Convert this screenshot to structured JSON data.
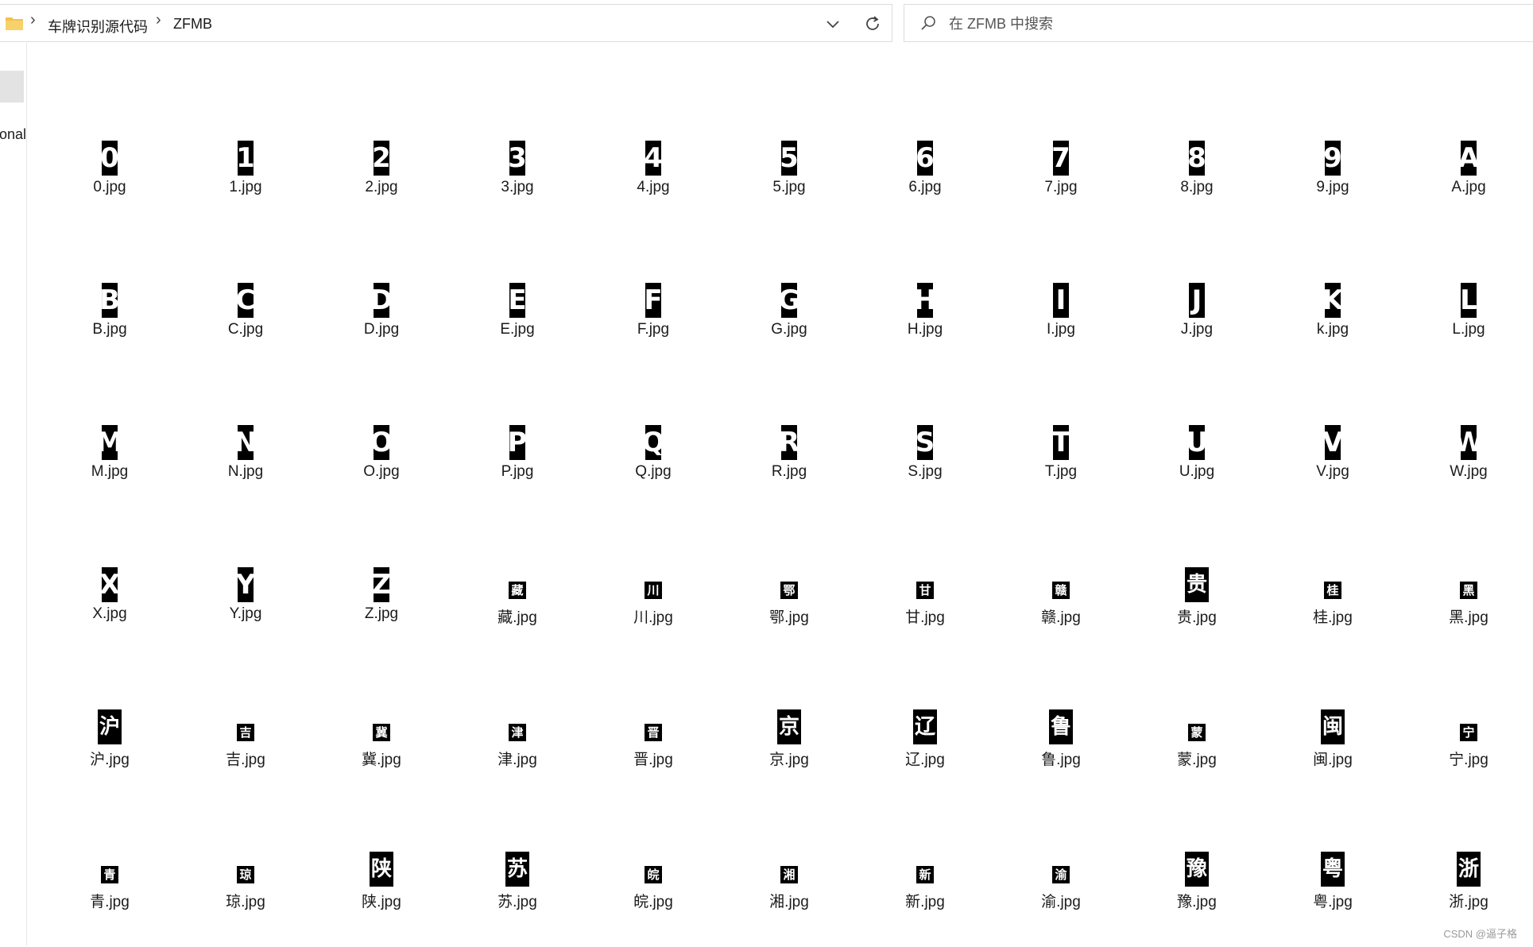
{
  "address_bar": {
    "crumbs": [
      "车牌识别源代码",
      "ZFMB"
    ],
    "separator": "›"
  },
  "search": {
    "placeholder": "在 ZFMB 中搜索"
  },
  "nav": {
    "visible_text": "onal"
  },
  "watermark": "CSDN @逼子格",
  "files": [
    {
      "glyph": "0",
      "name": "0.jpg",
      "size": "big"
    },
    {
      "glyph": "1",
      "name": "1.jpg",
      "size": "big"
    },
    {
      "glyph": "2",
      "name": "2.jpg",
      "size": "big"
    },
    {
      "glyph": "3",
      "name": "3.jpg",
      "size": "big"
    },
    {
      "glyph": "4",
      "name": "4.jpg",
      "size": "big"
    },
    {
      "glyph": "5",
      "name": "5.jpg",
      "size": "big"
    },
    {
      "glyph": "6",
      "name": "6.jpg",
      "size": "big"
    },
    {
      "glyph": "7",
      "name": "7.jpg",
      "size": "big"
    },
    {
      "glyph": "8",
      "name": "8.jpg",
      "size": "big"
    },
    {
      "glyph": "9",
      "name": "9.jpg",
      "size": "big"
    },
    {
      "glyph": "A",
      "name": "A.jpg",
      "size": "big"
    },
    {
      "glyph": "B",
      "name": "B.jpg",
      "size": "big"
    },
    {
      "glyph": "C",
      "name": "C.jpg",
      "size": "big"
    },
    {
      "glyph": "D",
      "name": "D.jpg",
      "size": "big"
    },
    {
      "glyph": "E",
      "name": "E.jpg",
      "size": "big"
    },
    {
      "glyph": "F",
      "name": "F.jpg",
      "size": "big"
    },
    {
      "glyph": "G",
      "name": "G.jpg",
      "size": "big"
    },
    {
      "glyph": "H",
      "name": "H.jpg",
      "size": "big"
    },
    {
      "glyph": "I",
      "name": "I.jpg",
      "size": "big"
    },
    {
      "glyph": "J",
      "name": "J.jpg",
      "size": "big"
    },
    {
      "glyph": "K",
      "name": "k.jpg",
      "size": "big"
    },
    {
      "glyph": "L",
      "name": "L.jpg",
      "size": "big"
    },
    {
      "glyph": "M",
      "name": "M.jpg",
      "size": "big"
    },
    {
      "glyph": "N",
      "name": "N.jpg",
      "size": "big"
    },
    {
      "glyph": "O",
      "name": "O.jpg",
      "size": "big"
    },
    {
      "glyph": "P",
      "name": "P.jpg",
      "size": "big"
    },
    {
      "glyph": "Q",
      "name": "Q.jpg",
      "size": "big"
    },
    {
      "glyph": "R",
      "name": "R.jpg",
      "size": "big"
    },
    {
      "glyph": "S",
      "name": "S.jpg",
      "size": "big"
    },
    {
      "glyph": "T",
      "name": "T.jpg",
      "size": "big"
    },
    {
      "glyph": "U",
      "name": "U.jpg",
      "size": "big"
    },
    {
      "glyph": "V",
      "name": "V.jpg",
      "size": "big"
    },
    {
      "glyph": "W",
      "name": "W.jpg",
      "size": "big"
    },
    {
      "glyph": "X",
      "name": "X.jpg",
      "size": "big"
    },
    {
      "glyph": "Y",
      "name": "Y.jpg",
      "size": "big"
    },
    {
      "glyph": "Z",
      "name": "Z.jpg",
      "size": "big"
    },
    {
      "glyph": "藏",
      "name": "藏.jpg",
      "size": "small"
    },
    {
      "glyph": "川",
      "name": "川.jpg",
      "size": "small"
    },
    {
      "glyph": "鄂",
      "name": "鄂.jpg",
      "size": "small"
    },
    {
      "glyph": "甘",
      "name": "甘.jpg",
      "size": "small"
    },
    {
      "glyph": "赣",
      "name": "赣.jpg",
      "size": "small"
    },
    {
      "glyph": "贵",
      "name": "贵.jpg",
      "size": "mid"
    },
    {
      "glyph": "桂",
      "name": "桂.jpg",
      "size": "small"
    },
    {
      "glyph": "黑",
      "name": "黑.jpg",
      "size": "small"
    },
    {
      "glyph": "沪",
      "name": "沪.jpg",
      "size": "mid"
    },
    {
      "glyph": "吉",
      "name": "吉.jpg",
      "size": "small"
    },
    {
      "glyph": "冀",
      "name": "冀.jpg",
      "size": "small"
    },
    {
      "glyph": "津",
      "name": "津.jpg",
      "size": "small"
    },
    {
      "glyph": "晋",
      "name": "晋.jpg",
      "size": "small"
    },
    {
      "glyph": "京",
      "name": "京.jpg",
      "size": "mid"
    },
    {
      "glyph": "辽",
      "name": "辽.jpg",
      "size": "mid"
    },
    {
      "glyph": "鲁",
      "name": "鲁.jpg",
      "size": "mid"
    },
    {
      "glyph": "蒙",
      "name": "蒙.jpg",
      "size": "small"
    },
    {
      "glyph": "闽",
      "name": "闽.jpg",
      "size": "mid"
    },
    {
      "glyph": "宁",
      "name": "宁.jpg",
      "size": "small"
    },
    {
      "glyph": "青",
      "name": "青.jpg",
      "size": "small"
    },
    {
      "glyph": "琼",
      "name": "琼.jpg",
      "size": "small"
    },
    {
      "glyph": "陕",
      "name": "陕.jpg",
      "size": "mid"
    },
    {
      "glyph": "苏",
      "name": "苏.jpg",
      "size": "mid"
    },
    {
      "glyph": "皖",
      "name": "皖.jpg",
      "size": "small"
    },
    {
      "glyph": "湘",
      "name": "湘.jpg",
      "size": "small"
    },
    {
      "glyph": "新",
      "name": "新.jpg",
      "size": "small"
    },
    {
      "glyph": "渝",
      "name": "渝.jpg",
      "size": "small"
    },
    {
      "glyph": "豫",
      "name": "豫.jpg",
      "size": "mid"
    },
    {
      "glyph": "粤",
      "name": "粤.jpg",
      "size": "mid"
    },
    {
      "glyph": "浙",
      "name": "浙.jpg",
      "size": "mid"
    }
  ]
}
